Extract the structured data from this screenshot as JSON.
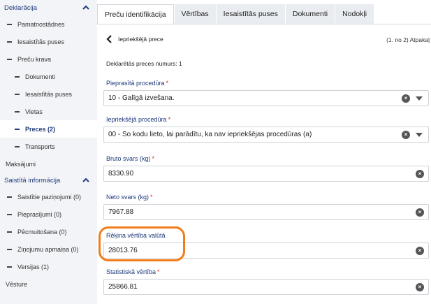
{
  "sidebar": {
    "sections": [
      {
        "id": "deklaracija",
        "label": "Deklarācija"
      },
      {
        "id": "saistita",
        "label": "Saistītā informācija"
      }
    ],
    "items": [
      {
        "label": "Pamatnostādnes"
      },
      {
        "label": "Iesaistītās puses"
      },
      {
        "label": "Preču krava"
      },
      {
        "label": "Dokumenti"
      },
      {
        "label": "Iesaistītās puses"
      },
      {
        "label": "Vietas"
      },
      {
        "label": "Preces (2)"
      },
      {
        "label": "Transports"
      },
      {
        "label": "Maksājumi"
      },
      {
        "label": "Saistītie paziņojumi (0)"
      },
      {
        "label": "Pieprasījumi (0)"
      },
      {
        "label": "Pēcmuitošana (0)"
      },
      {
        "label": "Ziņojumu apmaiņa (0)"
      },
      {
        "label": "Versijas (1)"
      },
      {
        "label": "Vēsture"
      }
    ]
  },
  "tabs": [
    {
      "label": "Preču identifikācija"
    },
    {
      "label": "Vērtības"
    },
    {
      "label": "Iesaistītās puses"
    },
    {
      "label": "Dokumenti"
    },
    {
      "label": "Nodokļi"
    }
  ],
  "main": {
    "back_label": "Iepriekšējā prece",
    "paging": "(1. no 2) Atpakaļ",
    "decl_label": "Deklarētās preces numurs:",
    "decl_value": "1",
    "required_mark": "*",
    "fields": [
      {
        "label": "Pieprasītā procedūra",
        "value": "10 - Galīgā izvešana.",
        "required": true
      },
      {
        "label": "Iepriekšējā procedūra",
        "value": "00 - Šo kodu lieto, lai parādītu, ka nav iepriekšējas procedūras (a)",
        "required": true
      },
      {
        "label": "Bruto svars (kg)",
        "value": "8330.90",
        "required": true
      },
      {
        "label": "Neto svars (kg)",
        "value": "7967.88",
        "required": true
      },
      {
        "label": "Rēķina vērtība valūtā",
        "value": "28013.76",
        "required": false
      },
      {
        "label": "Statistiskā vērtība",
        "value": "25866.81",
        "required": true
      }
    ],
    "clear_glyph": "×"
  },
  "colors": {
    "accent": "#1e3a7b",
    "required": "#d9262b",
    "highlight": "#f07d1a",
    "sidebar_bg": "#f2f4f7"
  }
}
